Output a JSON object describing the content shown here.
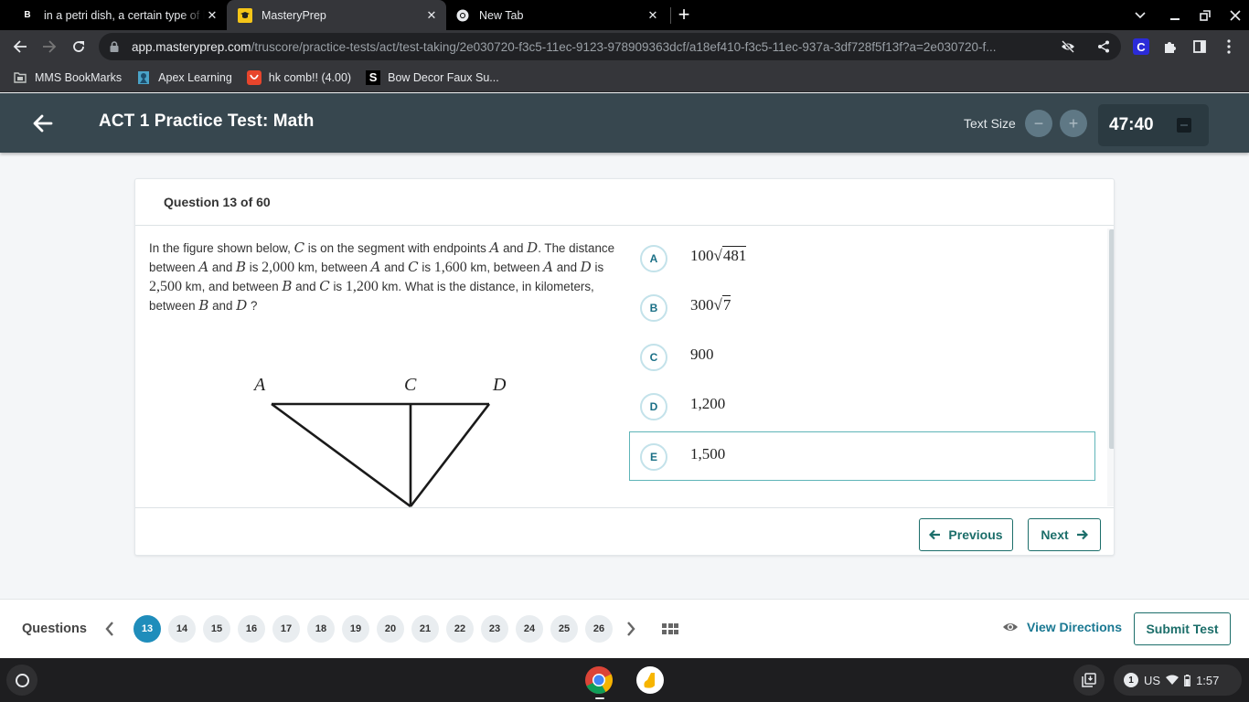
{
  "browser": {
    "tabs": [
      {
        "favicon": "brainly-icon",
        "favicon_glyph": "B",
        "title": "in a petri dish, a certain type of bacteria",
        "active": false
      },
      {
        "favicon": "masteryprep-icon",
        "title": "MasteryPrep",
        "active": true
      },
      {
        "favicon": "chrome-icon",
        "title": "New Tab",
        "active": false
      }
    ],
    "url_host": "app.masteryprep.com",
    "url_path": "/truscore/practice-tests/act/test-taking/2e030720-f3c5-11ec-9123-978909363dcf/a18ef410-f3c5-11ec-937a-3df728f5f13f?a=2e030720-f...",
    "bookmarks": [
      {
        "icon": "folder-icon",
        "label": "MMS BookMarks"
      },
      {
        "icon": "apex-icon",
        "label": "Apex Learning"
      },
      {
        "icon": "hk-icon",
        "label": "hk comb!! (4.00)"
      },
      {
        "icon": "s-icon",
        "label": "Bow Decor Faux Su..."
      }
    ],
    "extension_glyph": "C"
  },
  "header": {
    "title": "ACT 1 Practice Test: Math",
    "text_size_label": "Text Size",
    "decrease_glyph": "−",
    "increase_glyph": "+",
    "timer": "47:40"
  },
  "question": {
    "label": "Question 13 of 60",
    "stem": {
      "t1": "In the figure shown below, ",
      "v_C1": "C",
      "t2": " is on the segment with endpoints ",
      "v_A1": "A",
      "t3": " and ",
      "v_D1": "D",
      "t4": ". The distance between ",
      "v_A2": "A",
      "t5": " and ",
      "v_B1": "B",
      "t6": " is ",
      "n1": "2,000",
      "t7": " km, between ",
      "v_A3": "A",
      "t8": " and ",
      "v_C2": "C",
      "t9": " is ",
      "n2": "1,600",
      "t10": " km, between ",
      "v_A4": "A",
      "t11": " and ",
      "v_D2": "D",
      "t12": " is ",
      "n3": "2,500",
      "t13": " km, and between ",
      "v_B2": "B",
      "t14": " and ",
      "v_C3": "C",
      "t15": " is ",
      "n4": "1,200",
      "t16": " km. What is the distance, in kilometers, between ",
      "v_B3": "B",
      "t17": " and ",
      "v_D3": "D",
      "t18": " ?"
    },
    "figure": {
      "labels": {
        "A": "A",
        "C": "C",
        "D": "D"
      }
    },
    "choices": [
      {
        "letter": "A",
        "coef": "100",
        "radicand": "481",
        "selected": false
      },
      {
        "letter": "B",
        "coef": "300",
        "radicand": "7",
        "selected": false
      },
      {
        "letter": "C",
        "value": "900",
        "selected": false
      },
      {
        "letter": "D",
        "value": "1,200",
        "selected": false
      },
      {
        "letter": "E",
        "value": "1,500",
        "selected": true
      }
    ],
    "previous_label": "Previous",
    "next_label": "Next"
  },
  "navigator": {
    "label": "Questions",
    "current": "13",
    "numbers": [
      "13",
      "14",
      "15",
      "16",
      "17",
      "18",
      "19",
      "20",
      "21",
      "22",
      "23",
      "24",
      "25",
      "26"
    ],
    "view_directions_label": "View Directions",
    "submit_label": "Submit Test"
  },
  "shelf": {
    "notification_count": "1",
    "keyboard_layout": "US",
    "time": "1:57"
  },
  "colors": {
    "header_bg": "#37474f",
    "accent_teal": "#1c6e6a",
    "current_question": "#1f8dbb",
    "link_blue": "#1a7892"
  }
}
